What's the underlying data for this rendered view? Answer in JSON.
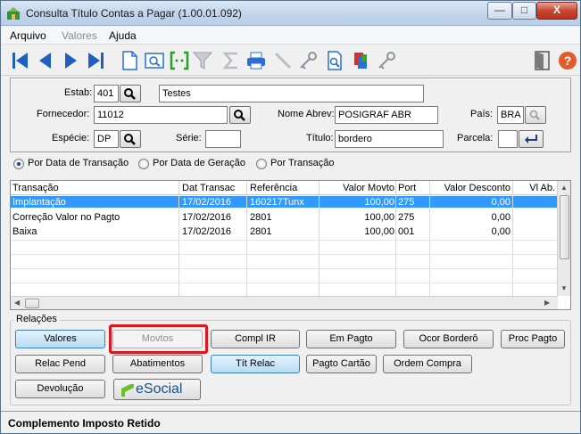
{
  "window": {
    "title": "Consulta Título Contas a Pagar (1.00.01.092)"
  },
  "menu": [
    {
      "label": "Arquivo",
      "disabled": false
    },
    {
      "label": "Valores",
      "disabled": true
    },
    {
      "label": "Ajuda",
      "disabled": false
    }
  ],
  "toolbar": {
    "icons": [
      "first-icon",
      "prev-icon",
      "next-icon",
      "last-icon",
      "new-doc-icon",
      "zoom-icon",
      "goto-icon",
      "filter-icon",
      "sum-icon",
      "print-icon",
      "edit-icon",
      "key-icon",
      "doc-search-icon",
      "stack-icon",
      "key2-icon",
      "exit-icon",
      "help-icon"
    ]
  },
  "form": {
    "estab_label": "Estab:",
    "estab_value": "401",
    "estab_desc": "Testes",
    "fornecedor_label": "Fornecedor:",
    "fornecedor_value": "11012",
    "nome_abrev_label": "Nome Abrev:",
    "nome_abrev_value": "POSIGRAF ABR",
    "pais_label": "País:",
    "pais_value": "BRA",
    "especie_label": "Espécie:",
    "especie_value": "DP",
    "serie_label": "Série:",
    "serie_value": "",
    "titulo_label": "Título:",
    "titulo_value": "bordero",
    "parcela_label": "Parcela:",
    "parcela_value": ""
  },
  "sort_options": [
    {
      "label": "Por Data de Transação",
      "checked": true
    },
    {
      "label": "Por Data de Geração",
      "checked": false
    },
    {
      "label": "Por Transação",
      "checked": false
    }
  ],
  "grid": {
    "columns": [
      "Transação",
      "Dat Transac",
      "Referência",
      "Valor Movto",
      "Port",
      "Valor Desconto",
      "Vl Ab."
    ],
    "rows": [
      {
        "transacao": "Implantação",
        "data": "17/02/2016",
        "referencia": "160217Tunx",
        "valor": "100,00",
        "port": "275",
        "desconto": "0,00",
        "selected": true
      },
      {
        "transacao": "Correção Valor no Pagto",
        "data": "17/02/2016",
        "referencia": "2801",
        "valor": "100,00",
        "port": "275",
        "desconto": "0,00",
        "selected": false
      },
      {
        "transacao": "Baixa",
        "data": "17/02/2016",
        "referencia": "2801",
        "valor": "100,00",
        "port": "001",
        "desconto": "0,00",
        "selected": false
      }
    ]
  },
  "relacoes": {
    "title": "Relações",
    "row1": [
      "Valores",
      "Movtos",
      "Compl IR",
      "Em Pagto",
      "Ocor Borderô",
      "Proc Pagto"
    ],
    "row2": [
      "Relac Pend",
      "Abatimentos",
      "Tít Relac",
      "Pagto Cartão",
      "Ordem Compra"
    ],
    "row3_devolucao": "Devolução",
    "esocial": "eSocial"
  },
  "status": "Complemento Imposto Retido",
  "colors": {
    "selection": "#3399ff",
    "highlight_border": "#e0161b",
    "toolbar_blue": "#1e5fbf"
  }
}
